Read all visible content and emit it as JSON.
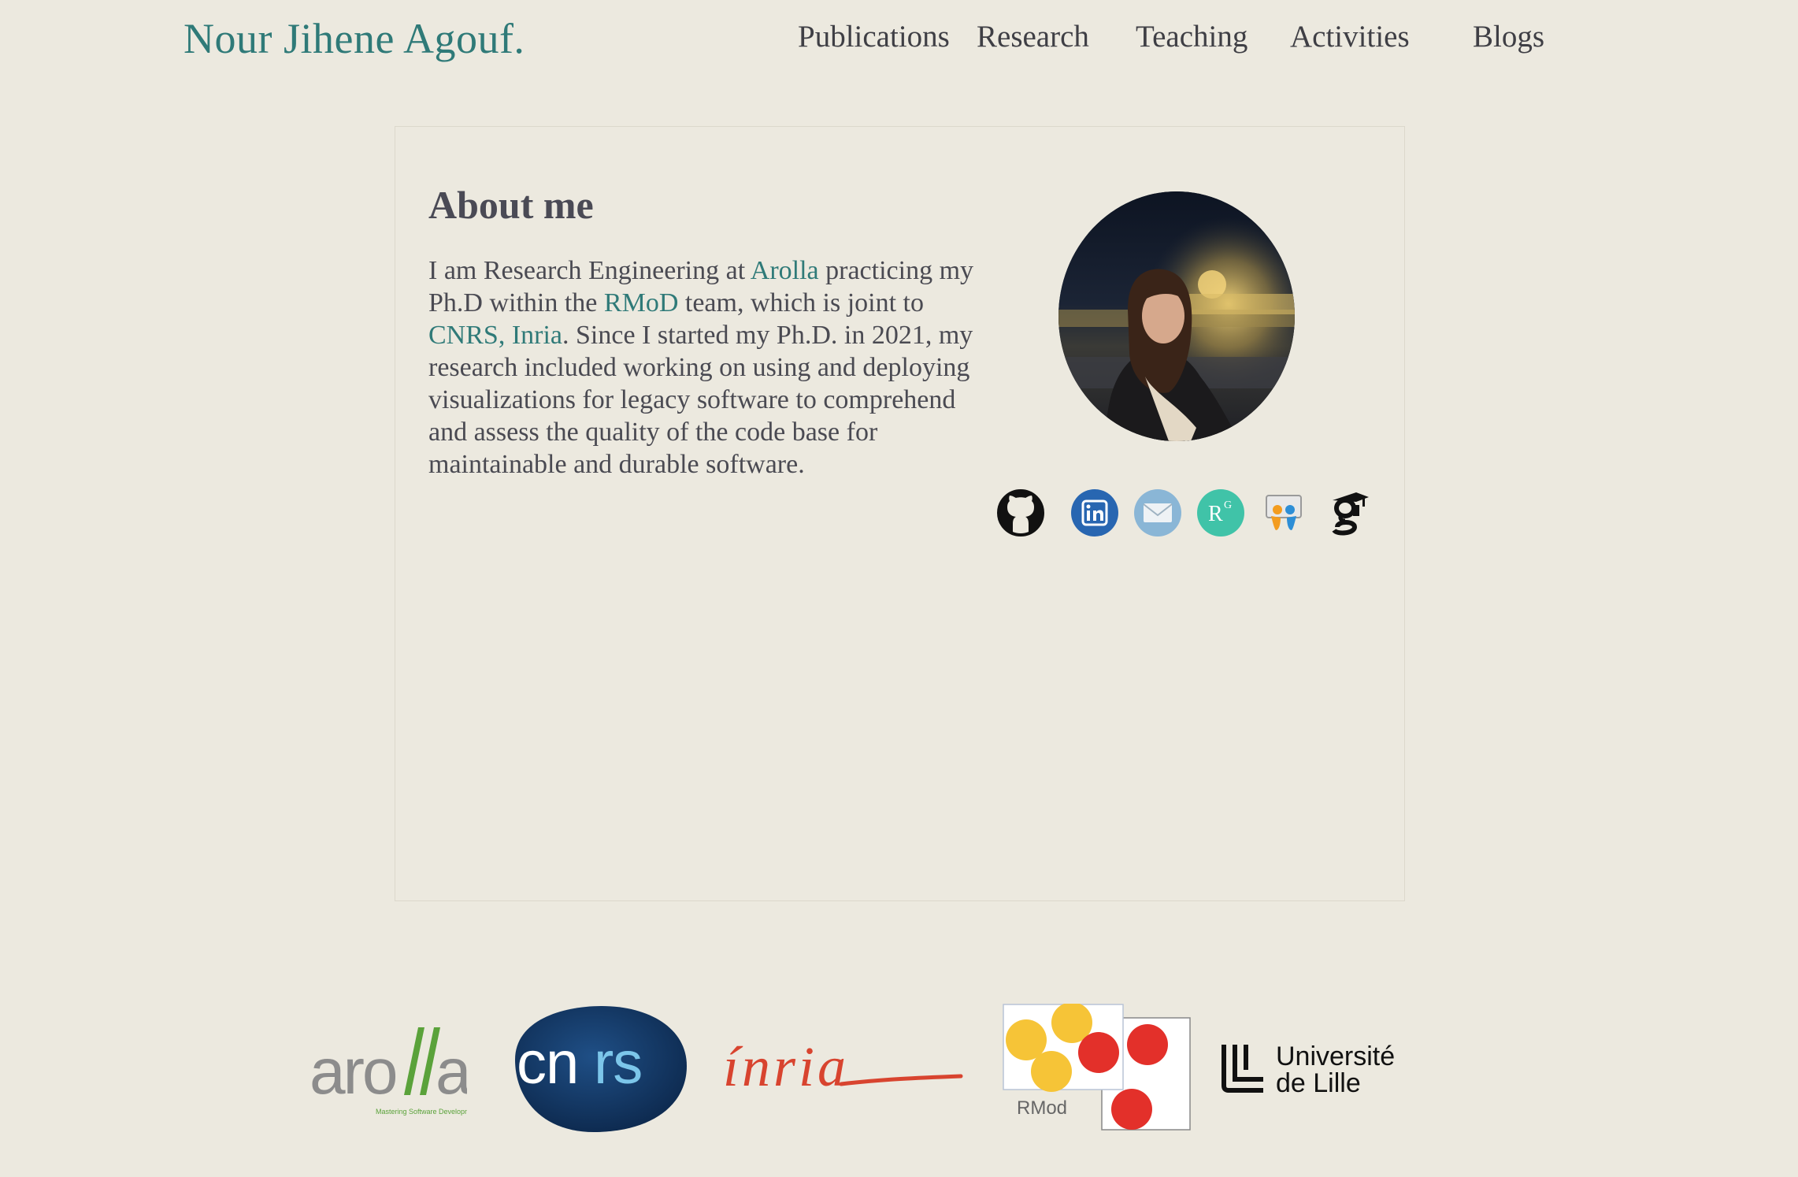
{
  "header": {
    "site_title": "Nour Jihene Agouf.",
    "nav": [
      "Publications",
      "Research",
      "Teaching",
      "Activities",
      "Blogs"
    ]
  },
  "about": {
    "heading": "About me",
    "text_1": "I am Research Engineering at ",
    "link_arolla": "Arolla",
    "text_2": " practicing my Ph.D within the ",
    "link_rmod": "RMoD",
    "text_3": " team, which is joint to ",
    "link_cnrs_inria": "CNRS, Inria",
    "text_4": ". Since I started my Ph.D. in 2021, my research included working on using and deploying visualizations for legacy software to comprehend and assess the quality of the code base for maintainable and durable software."
  },
  "socials": [
    {
      "name": "github-icon"
    },
    {
      "name": "linkedin-icon"
    },
    {
      "name": "email-icon"
    },
    {
      "name": "researchgate-icon"
    },
    {
      "name": "slideshare-icon"
    },
    {
      "name": "google-scholar-icon"
    }
  ],
  "logos": {
    "arolla": {
      "text": "arolla",
      "tagline": "Mastering Software Development"
    },
    "cnrs": {
      "text": "cnrs"
    },
    "inria": {
      "text": "Inria"
    },
    "rmod": {
      "text": "RMod"
    },
    "lille": {
      "line1": "Université",
      "line2": "de Lille"
    }
  },
  "colors": {
    "background": "#ece9df",
    "accent": "#2f7a78",
    "text": "#4a4a52"
  }
}
